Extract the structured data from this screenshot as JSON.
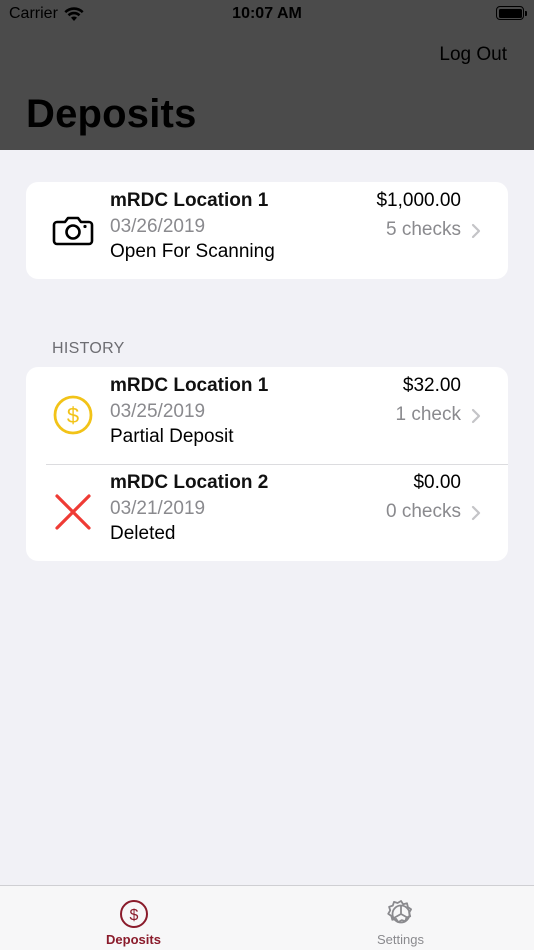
{
  "status_bar": {
    "carrier": "Carrier",
    "time": "10:07 AM"
  },
  "nav": {
    "logout_label": "Log Out",
    "title": "Deposits"
  },
  "open_deposit": {
    "name": "mRDC Location 1",
    "date": "03/26/2019",
    "status": "Open For Scanning",
    "amount": "$1,000.00",
    "checks": "5 checks",
    "icon": "camera-icon"
  },
  "history": {
    "label": "HISTORY",
    "items": [
      {
        "name": "mRDC Location 1",
        "date": "03/25/2019",
        "status": "Partial Deposit",
        "amount": "$32.00",
        "checks": "1 check",
        "icon": "dollar-circle-icon",
        "icon_color": "#f2c318"
      },
      {
        "name": "mRDC Location 2",
        "date": "03/21/2019",
        "status": "Deleted",
        "amount": "$0.00",
        "checks": "0 checks",
        "icon": "x-icon",
        "icon_color": "#ef3b35"
      }
    ]
  },
  "tabs": [
    {
      "label": "Deposits",
      "icon": "dollar-circle-icon",
      "active": true
    },
    {
      "label": "Settings",
      "icon": "gear-icon",
      "active": false
    }
  ],
  "colors": {
    "header_bg": "#4b4b4b",
    "accent": "#8a1b2b",
    "page_bg": "#f1f1f6"
  }
}
